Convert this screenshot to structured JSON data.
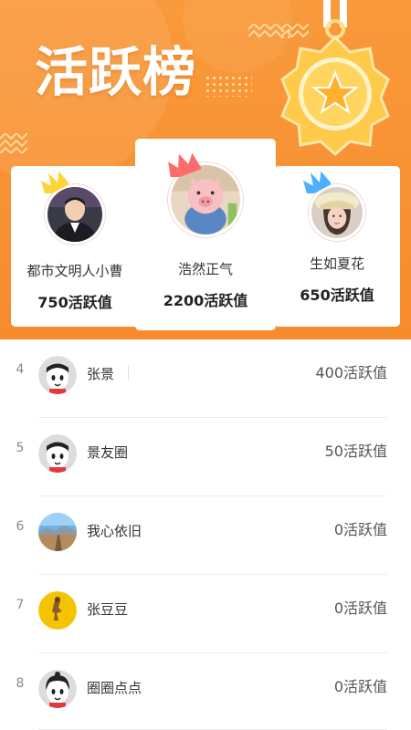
{
  "header": {
    "title": "活跃榜",
    "colors": {
      "background": "#f68b2d",
      "medal": "#ffb13a"
    }
  },
  "podium": [
    {
      "rank": 2,
      "name": "都市文明人小曹",
      "score": "750活跃值",
      "crown_color": "#ffd43b"
    },
    {
      "rank": 1,
      "name": "浩然正气",
      "score": "2200活跃值",
      "crown_color": "#ff6b6b"
    },
    {
      "rank": 3,
      "name": "生如夏花",
      "score": "650活跃值",
      "crown_color": "#4db0ff"
    }
  ],
  "ranking": [
    {
      "rank": "4",
      "name": "张景",
      "score": "400活跃值",
      "avatar": "cartoon-boy-icon"
    },
    {
      "rank": "5",
      "name": "景友圈",
      "score": "50活跃值",
      "avatar": "cartoon-boy-icon"
    },
    {
      "rank": "6",
      "name": "我心依旧",
      "score": "0活跃值",
      "avatar": "landscape-photo"
    },
    {
      "rank": "7",
      "name": "张豆豆",
      "score": "0活跃值",
      "avatar": "yellow-figure-icon"
    },
    {
      "rank": "8",
      "name": "圈圈点点",
      "score": "0活跃值",
      "avatar": "cartoon-girl-icon"
    }
  ]
}
